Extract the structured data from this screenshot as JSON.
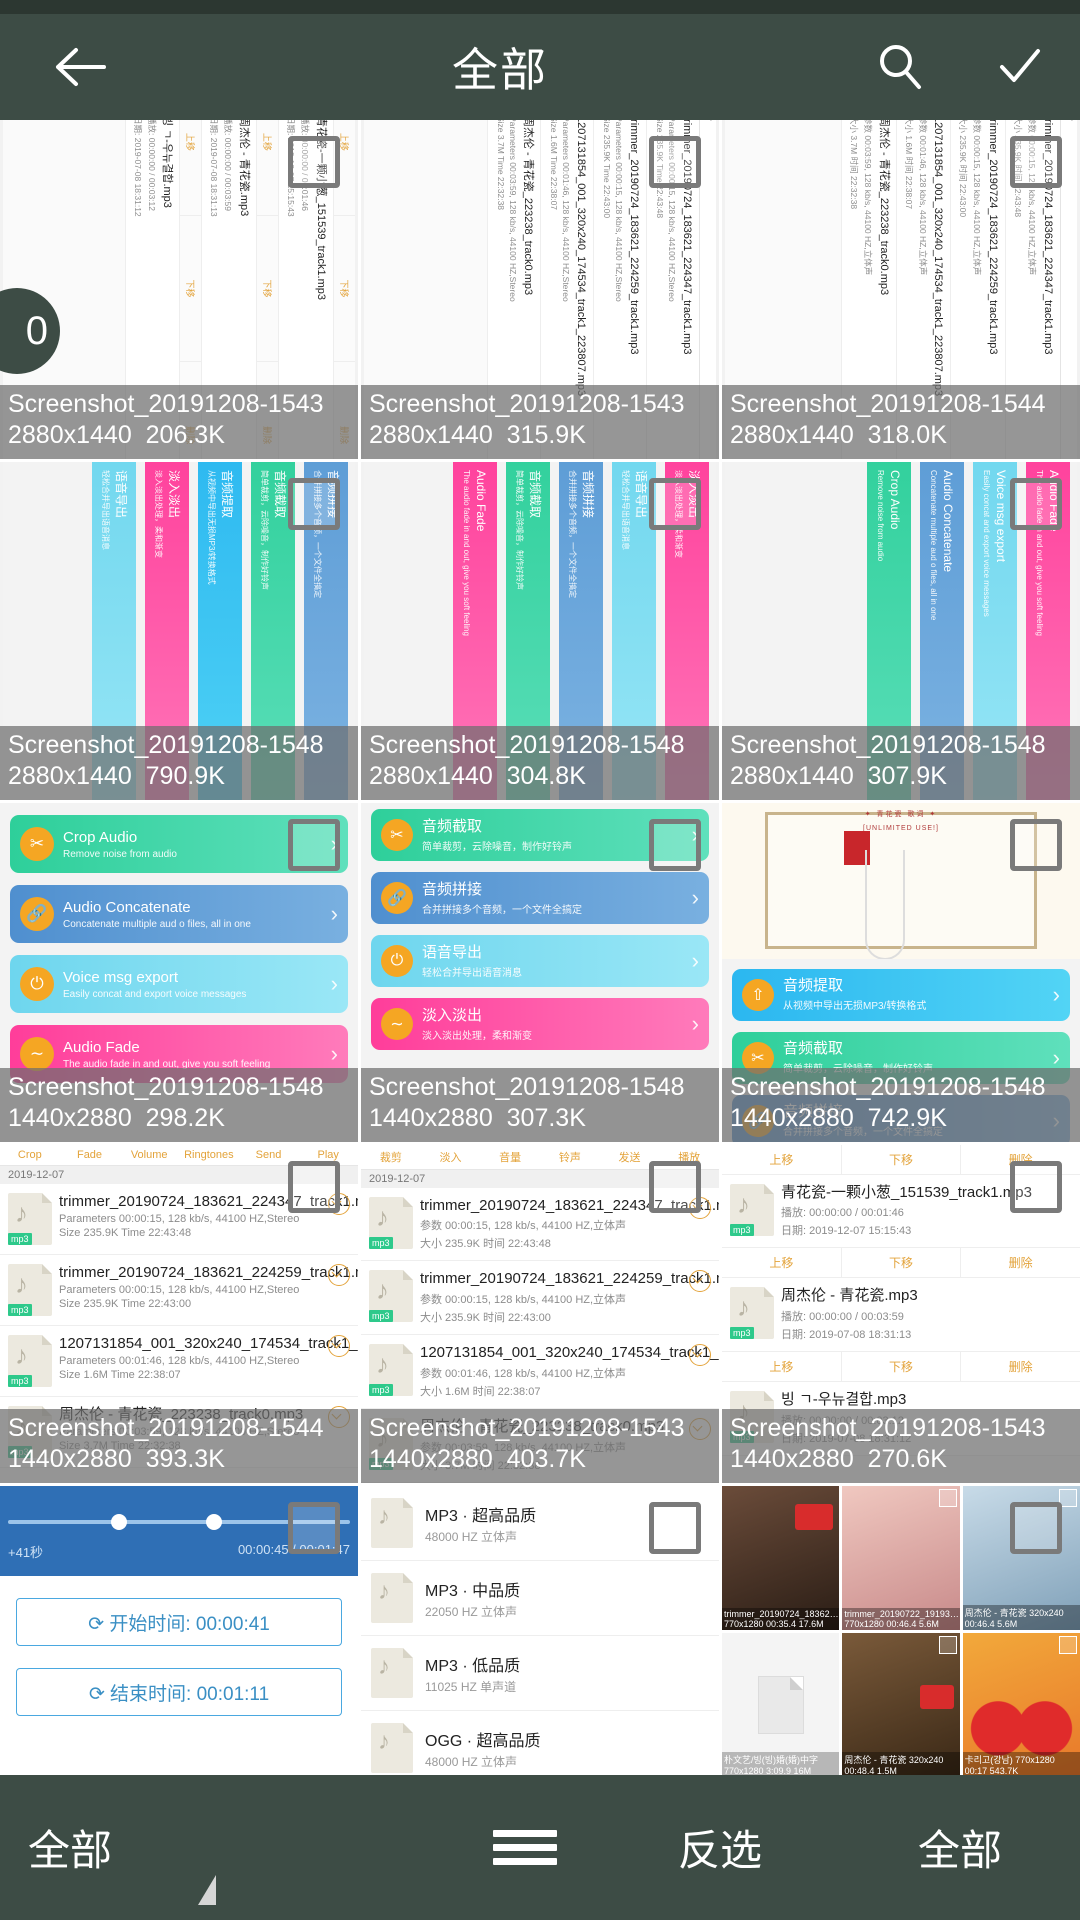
{
  "app": {
    "topbar": {
      "title": "全部",
      "back_icon": "arrow-left-icon",
      "search_icon": "search-icon",
      "confirm_icon": "check-icon"
    },
    "bottombar": {
      "left_label": "全部",
      "menu_icon": "hamburger-menu-icon",
      "invert_label": "反选",
      "right_label": "全部"
    },
    "selection_badge": "0"
  },
  "grid": {
    "items": [
      {
        "name": "Screenshot_20191208-1543",
        "dimensions": "2880x1440",
        "size": "206.3K",
        "kind": "audio-list-rotated",
        "selected": false
      },
      {
        "name": "Screenshot_20191208-1543",
        "dimensions": "2880x1440",
        "size": "315.9K",
        "kind": "audio-list-rotated",
        "selected": false
      },
      {
        "name": "Screenshot_20191208-1544",
        "dimensions": "2880x1440",
        "size": "318.0K",
        "kind": "audio-list-rotated",
        "selected": false
      },
      {
        "name": "Screenshot_20191208-1548",
        "dimensions": "2880x1440",
        "size": "790.9K",
        "kind": "feature-cards-rotated",
        "selected": false
      },
      {
        "name": "Screenshot_20191208-1548",
        "dimensions": "2880x1440",
        "size": "304.8K",
        "kind": "feature-cards-rotated",
        "selected": false
      },
      {
        "name": "Screenshot_20191208-1548",
        "dimensions": "2880x1440",
        "size": "307.9K",
        "kind": "feature-cards-rotated-en",
        "selected": false
      },
      {
        "name": "Screenshot_20191208-1548",
        "dimensions": "1440x2880",
        "size": "298.2K",
        "kind": "feature-cards-en",
        "selected": false
      },
      {
        "name": "Screenshot_20191208-1548",
        "dimensions": "1440x2880",
        "size": "307.3K",
        "kind": "feature-cards-cn",
        "selected": false
      },
      {
        "name": "Screenshot_20191208-1548",
        "dimensions": "1440x2880",
        "size": "742.9K",
        "kind": "feature-cards-poster",
        "selected": false
      },
      {
        "name": "Screenshot_20191208-1544",
        "dimensions": "1440x2880",
        "size": "393.3K",
        "kind": "audio-list-en",
        "selected": false
      },
      {
        "name": "Screenshot_20191208-1543",
        "dimensions": "1440x2880",
        "size": "403.7K",
        "kind": "audio-list-cn",
        "selected": false
      },
      {
        "name": "Screenshot_20191208-1543",
        "dimensions": "1440x2880",
        "size": "270.6K",
        "kind": "audio-list-move",
        "selected": false
      }
    ]
  },
  "thumb_content": {
    "audio_list_en": {
      "date_header": "2019-12-07",
      "rows": [
        {
          "title": "trimmer_20190724_183621_224347_track1.mp3",
          "line1": "Parameters  00:00:15, 128 kb/s, 44100 HZ,Stereo",
          "line2": "Size  235.9K    Time  22:43:48",
          "tag": "mp3"
        },
        {
          "title": "trimmer_20190724_183621_224259_track1.mp3",
          "line1": "Parameters  00:00:15, 128 kb/s, 44100 HZ,Stereo",
          "line2": "Size  235.9K    Time  22:43:00",
          "tag": "mp3"
        },
        {
          "title": "1207131854_001_320x240_174534_track1_223807.mp3",
          "line1": "Parameters  00:01:46, 128 kb/s, 44100 HZ,Stereo",
          "line2": "Size  1.6M     Time  22:38:07",
          "tag": "mp3"
        },
        {
          "title": "周杰伦 - 青花瓷_223238_track0.mp3",
          "line1": "Parameters  00:03:59, 128 kb/s, 44100 HZ,Stereo",
          "line2": "Size  3.7M     Time  22:32:38",
          "tag": "mp3"
        }
      ]
    },
    "audio_list_cn": {
      "date_header": "2019-12-07",
      "rows": [
        {
          "title": "trimmer_20190724_183621_224347_track1.mp3",
          "line1": "参数  00:00:15, 128 kb/s, 44100 HZ,立体声",
          "line2": "大小  235.9K    时间  22:43:48",
          "tag": "mp3"
        },
        {
          "title": "trimmer_20190724_183621_224259_track1.mp3",
          "line1": "参数  00:00:15, 128 kb/s, 44100 HZ,立体声",
          "line2": "大小  235.9K    时间  22:43:00",
          "tag": "mp3"
        },
        {
          "title": "1207131854_001_320x240_174534_track1_223807.mp3",
          "line1": "参数  00:01:46, 128 kb/s, 44100 HZ,立体声",
          "line2": "大小  1.6M     时间  22:38:07",
          "tag": "mp3"
        },
        {
          "title": "周杰伦 - 青花瓷_223238_track0.mp3",
          "line1": "参数  00:03:59, 128 kb/s, 44100 HZ,立体声",
          "line2": "大小  3.7M     时间  22:32:38",
          "tag": "mp3"
        }
      ]
    },
    "audio_list_move": {
      "actions": [
        "上移",
        "下移",
        "删除"
      ],
      "rows": [
        {
          "title": "青花瓷-一颗小葱_151539_track1.mp3",
          "line1": "播放:  00:00:00 / 00:01:46",
          "line2": "日期:  2019-12-07 15:15:43",
          "tag": "mp3"
        },
        {
          "title": "周杰伦 - 青花瓷.mp3",
          "line1": "播放:  00:00:00 / 00:03:59",
          "line2": "日期:  2019-07-08 18:31:13",
          "tag": "mp3"
        },
        {
          "title": "빙 ㄱ-우뉴결합.mp3",
          "line1": "播放:  00:00:00 / 00:03:12",
          "line2": "日期:  2019-07-08 18:31:12",
          "tag": "mp3"
        }
      ]
    },
    "feature_cards_cn": [
      {
        "title": "音频拼接",
        "subtitle": "合并拼接多个音频，一个文件全搞定",
        "color": "#5b9bd5",
        "icon": "link-icon"
      },
      {
        "title": "音频截取",
        "subtitle": "简单裁剪，云除噪音，制作好铃声",
        "color": "#2ecf9a",
        "icon": "scissors-icon"
      },
      {
        "title": "音频提取",
        "subtitle": "从视频中导出无损MP3/转换格式",
        "color": "#2bb7f0",
        "icon": "extract-icon"
      },
      {
        "title": "淡入淡出",
        "subtitle": "淡入淡出处理，柔和渐变",
        "color": "#ff3d9a",
        "icon": "wave-icon"
      },
      {
        "title": "语音导出",
        "subtitle": "轻松合并导出语音消息",
        "color": "#6ed6ee",
        "icon": "mic-icon"
      }
    ],
    "feature_cards_en": [
      {
        "title": "Crop Audio",
        "subtitle": "Remove noise from audio",
        "color": "#2ecf9a",
        "icon": "scissors-icon"
      },
      {
        "title": "Audio Concatenate",
        "subtitle": "Concatenate multiple aud o files, all in one",
        "color": "#5b9bd5",
        "icon": "link-icon"
      },
      {
        "title": "Voice msg export",
        "subtitle": "Easily concat and export voice messages",
        "color": "#6ed6ee",
        "icon": "mic-icon"
      },
      {
        "title": "Audio Fade",
        "subtitle": "The audio fade in and out, give you soft feeling",
        "color": "#ff3d9a",
        "icon": "wave-icon"
      }
    ],
    "editor": {
      "start_label": "⟳ 开始时间: 00:00:41",
      "end_label": "⟳ 结束时间: 00:01:11",
      "left_time": "+41秒",
      "right_time": "00:00:45 / 00:01:47"
    },
    "quality_list": [
      {
        "title": "MP3 · 超高品质",
        "sub": "48000 HZ 立体声"
      },
      {
        "title": "MP3 · 中品质",
        "sub": "22050 HZ 立体声"
      },
      {
        "title": "MP3 · 低品质",
        "sub": "11025 HZ 单声道"
      },
      {
        "title": "OGG · 超高品质",
        "sub": "48000 HZ 立体声"
      }
    ],
    "gallery_caps": [
      "trimmer_20190724_18362…  770x1280  00:35.4 17.6M",
      "trimmer_20190722_19193…  770x1280  00:46.4 5.6M",
      "周杰伦 - 青花瓷 320x240  00:46.4 5.6M",
      "朴文艺/빙(빙)婚(婚)中字 770x1280  3:09.9 16M",
      "周杰伦 - 青花瓷 320x240  00:48.4 1.5M",
      "卡리고(강남)  770x1280  00:17  543.7K"
    ],
    "poster": {
      "top_text": "✦ 青花瓷 歌词 ✦",
      "unlimited": "[UNLIMITED USE!]"
    }
  }
}
